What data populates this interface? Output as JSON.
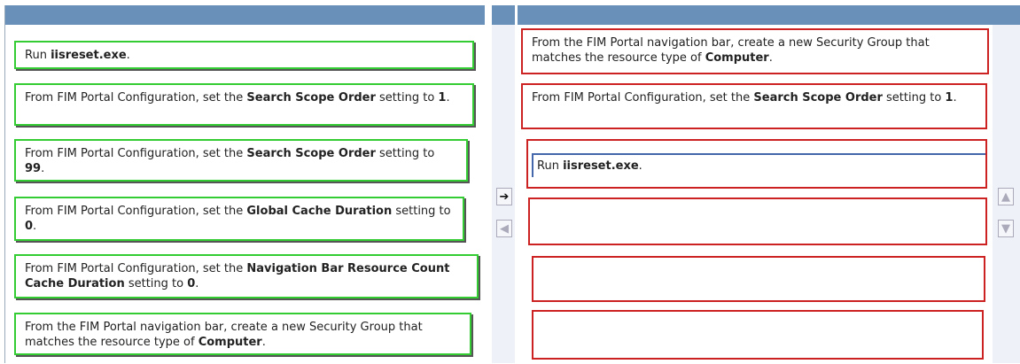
{
  "left_items": [
    {
      "pre": "Run ",
      "bold": "iisreset.exe",
      "post": "."
    },
    {
      "pre": "From FIM Portal Configuration, set the ",
      "bold": "Search Scope Order",
      "post": " setting to ",
      "bold2": "1",
      "post2": "."
    },
    {
      "pre": "From FIM Portal Configuration, set the ",
      "bold": "Search Scope Order",
      "post": " setting to ",
      "bold2": "99",
      "post2": "."
    },
    {
      "pre": "From FIM Portal Configuration, set the ",
      "bold": "Global Cache Duration",
      "post": " setting to ",
      "bold2": "0",
      "post2": "."
    },
    {
      "pre": "From FIM Portal Configuration, set the ",
      "bold": "Navigation Bar Resource Count Cache Duration",
      "post": " setting to ",
      "bold2": "0",
      "post2": "."
    },
    {
      "pre": "From the FIM Portal navigation bar, create a new Security Group that matches the resource type of ",
      "bold": "Computer",
      "post": "."
    }
  ],
  "right_items": [
    {
      "pre": "From the FIM Portal navigation bar, create a new Security Group that matches the resource type of ",
      "bold": "Computer",
      "post": "."
    },
    {
      "pre": "From FIM Portal Configuration, set the ",
      "bold": "Search Scope Order",
      "post": " setting to ",
      "bold2": "1",
      "post2": "."
    },
    {
      "pre": "Run ",
      "bold": "iisreset.exe",
      "post": "."
    },
    {
      "pre": "",
      "bold": "",
      "post": ""
    },
    {
      "pre": "",
      "bold": "",
      "post": ""
    },
    {
      "pre": "",
      "bold": "",
      "post": ""
    }
  ],
  "buttons": {
    "move_right": "arrow-right-icon",
    "move_left": "arrow-left-icon",
    "move_up": "arrow-up-icon",
    "move_down": "arrow-down-icon"
  },
  "colors": {
    "header": "#6890b8",
    "source_border": "#33cc33",
    "target_border": "#cc2222"
  }
}
